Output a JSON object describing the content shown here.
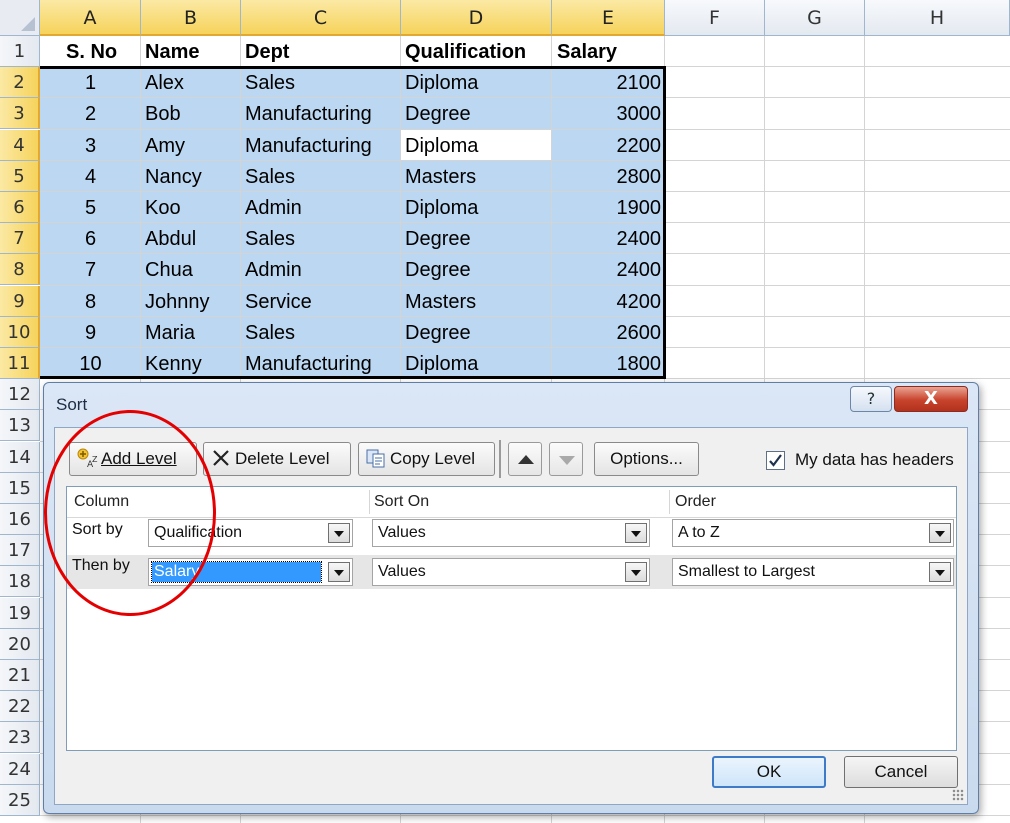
{
  "sheet": {
    "columns": [
      "A",
      "B",
      "C",
      "D",
      "E",
      "F",
      "G",
      "H"
    ],
    "rows": [
      "1",
      "2",
      "3",
      "4",
      "5",
      "6",
      "7",
      "8",
      "9",
      "10",
      "11",
      "12",
      "13",
      "14",
      "15",
      "16",
      "17",
      "18",
      "19",
      "20",
      "21",
      "22",
      "23",
      "24",
      "25"
    ],
    "headers": {
      "sno": "S. No",
      "name": "Name",
      "dept": "Dept",
      "qual": "Qualification",
      "salary": "Salary"
    },
    "data": [
      {
        "sno": "1",
        "name": "Alex",
        "dept": "Sales",
        "qual": "Diploma",
        "salary": "2100"
      },
      {
        "sno": "2",
        "name": "Bob",
        "dept": "Manufacturing",
        "qual": "Degree",
        "salary": "3000"
      },
      {
        "sno": "3",
        "name": "Amy",
        "dept": "Manufacturing",
        "qual": "Diploma",
        "salary": "2200"
      },
      {
        "sno": "4",
        "name": "Nancy",
        "dept": "Sales",
        "qual": "Masters",
        "salary": "2800"
      },
      {
        "sno": "5",
        "name": "Koo",
        "dept": "Admin",
        "qual": "Diploma",
        "salary": "1900"
      },
      {
        "sno": "6",
        "name": "Abdul",
        "dept": "Sales",
        "qual": "Degree",
        "salary": "2400"
      },
      {
        "sno": "7",
        "name": "Chua",
        "dept": "Admin",
        "qual": "Degree",
        "salary": "2400"
      },
      {
        "sno": "8",
        "name": "Johnny",
        "dept": "Service",
        "qual": "Masters",
        "salary": "4200"
      },
      {
        "sno": "9",
        "name": "Maria",
        "dept": "Sales",
        "qual": "Degree",
        "salary": "2600"
      },
      {
        "sno": "10",
        "name": "Kenny",
        "dept": "Manufacturing",
        "qual": "Diploma",
        "salary": "1800"
      }
    ]
  },
  "dialog": {
    "title": "Sort",
    "help_label": "?",
    "close_label": "X",
    "toolbar": {
      "add_level": "Add Level",
      "delete_level": "Delete Level",
      "copy_level": "Copy Level",
      "options": "Options..."
    },
    "my_data_has_headers": "My data has headers",
    "headers_checked": true,
    "columns_header": {
      "column": "Column",
      "sort_on": "Sort On",
      "order": "Order"
    },
    "levels": [
      {
        "label": "Sort by",
        "column": "Qualification",
        "sort_on": "Values",
        "order": "A to Z"
      },
      {
        "label": "Then by",
        "column": "Salary",
        "sort_on": "Values",
        "order": "Smallest to Largest"
      }
    ],
    "ok_label": "OK",
    "cancel_label": "Cancel"
  },
  "colors": {
    "selection": "#bcd7f1",
    "annotation": "#e40000",
    "accent": "#3d7bc9"
  },
  "icons": [
    "add-level-icon",
    "delete-level-icon",
    "copy-level-icon",
    "move-up-icon",
    "move-down-icon",
    "checkbox-check-icon",
    "dropdown-arrow-icon"
  ]
}
